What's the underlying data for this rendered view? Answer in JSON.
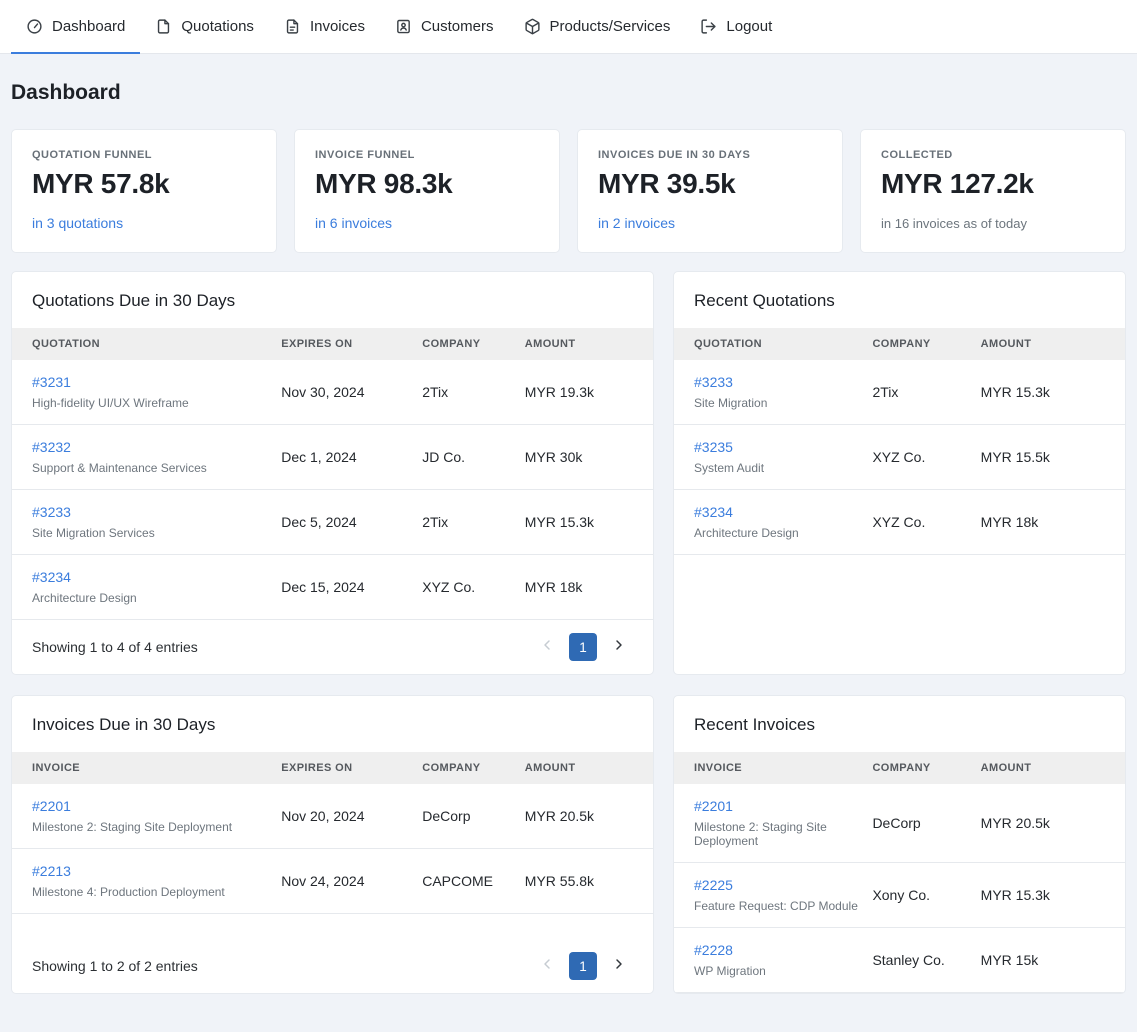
{
  "colors": {
    "accent-link": "#3b7ddd",
    "pagination-active": "#2f6ab4"
  },
  "nav": {
    "items": [
      {
        "label": "Dashboard",
        "icon": "dashboard-gauge-icon",
        "active": true
      },
      {
        "label": "Quotations",
        "icon": "quotation-file-icon",
        "active": false
      },
      {
        "label": "Invoices",
        "icon": "invoice-file-icon",
        "active": false
      },
      {
        "label": "Customers",
        "icon": "customers-badge-icon",
        "active": false
      },
      {
        "label": "Products/Services",
        "icon": "products-box-icon",
        "active": false
      },
      {
        "label": "Logout",
        "icon": "logout-icon",
        "active": false
      }
    ]
  },
  "page_title": "Dashboard",
  "stats": [
    {
      "label": "QUOTATION FUNNEL",
      "value": "MYR 57.8k",
      "sub": "in 3 quotations"
    },
    {
      "label": "INVOICE FUNNEL",
      "value": "MYR 98.3k",
      "sub": "in 6 invoices"
    },
    {
      "label": "INVOICES DUE IN 30 DAYS",
      "value": "MYR 39.5k",
      "sub": "in 2 invoices"
    },
    {
      "label": "COLLECTED",
      "value": "MYR 127.2k",
      "sub": "in 16 invoices as of today"
    }
  ],
  "quotations_due": {
    "title": "Quotations Due in 30 Days",
    "headers": [
      "QUOTATION",
      "EXPIRES ON",
      "COMPANY",
      "AMOUNT"
    ],
    "rows": [
      {
        "id": "#3231",
        "desc": "High-fidelity UI/UX Wireframe",
        "expires": "Nov 30, 2024",
        "company": "2Tix",
        "amount": "MYR 19.3k"
      },
      {
        "id": "#3232",
        "desc": "Support & Maintenance Services",
        "expires": "Dec 1, 2024",
        "company": "JD Co.",
        "amount": "MYR 30k"
      },
      {
        "id": "#3233",
        "desc": "Site Migration Services",
        "expires": "Dec 5, 2024",
        "company": "2Tix",
        "amount": "MYR 15.3k"
      },
      {
        "id": "#3234",
        "desc": "Architecture Design",
        "expires": "Dec 15, 2024",
        "company": "XYZ Co.",
        "amount": "MYR 18k"
      }
    ],
    "footer_text": "Showing 1 to 4 of 4 entries",
    "page": "1"
  },
  "recent_quotations": {
    "title": "Recent Quotations",
    "headers": [
      "QUOTATION",
      "COMPANY",
      "AMOUNT"
    ],
    "rows": [
      {
        "id": "#3233",
        "desc": "Site Migration",
        "company": "2Tix",
        "amount": "MYR 15.3k"
      },
      {
        "id": "#3235",
        "desc": "System Audit",
        "company": "XYZ Co.",
        "amount": "MYR 15.5k"
      },
      {
        "id": "#3234",
        "desc": "Architecture Design",
        "company": "XYZ Co.",
        "amount": "MYR 18k"
      }
    ]
  },
  "invoices_due": {
    "title": "Invoices Due in 30 Days",
    "headers": [
      "INVOICE",
      "EXPIRES ON",
      "COMPANY",
      "AMOUNT"
    ],
    "rows": [
      {
        "id": "#2201",
        "desc": "Milestone 2: Staging Site Deployment",
        "expires": "Nov 20, 2024",
        "company": "DeCorp",
        "amount": "MYR 20.5k"
      },
      {
        "id": "#2213",
        "desc": "Milestone 4: Production Deployment",
        "expires": "Nov 24, 2024",
        "company": "CAPCOME",
        "amount": "MYR 55.8k"
      }
    ],
    "footer_text": "Showing 1 to 2 of 2 entries",
    "page": "1"
  },
  "recent_invoices": {
    "title": "Recent Invoices",
    "headers": [
      "INVOICE",
      "COMPANY",
      "AMOUNT"
    ],
    "rows": [
      {
        "id": "#2201",
        "desc": "Milestone 2: Staging Site Deployment",
        "company": "DeCorp",
        "amount": "MYR 20.5k"
      },
      {
        "id": "#2225",
        "desc": "Feature Request: CDP Module",
        "company": "Xony Co.",
        "amount": "MYR 15.3k"
      },
      {
        "id": "#2228",
        "desc": "WP Migration",
        "company": "Stanley Co.",
        "amount": "MYR 15k"
      }
    ]
  }
}
